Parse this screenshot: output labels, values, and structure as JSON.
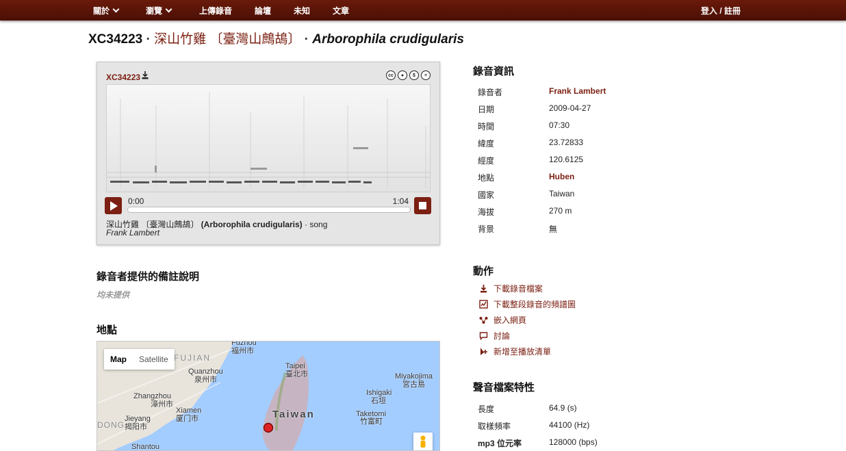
{
  "nav": {
    "about": "關於",
    "browse": "瀏覽",
    "upload": "上傳錄音",
    "forum": "論壇",
    "mystery": "未知",
    "articles": "文章",
    "login": "登入 / 註冊"
  },
  "title": {
    "id": "XC34223",
    "sep1": " · ",
    "common_name": "深山竹雞 〔臺灣山鷓鴣〕",
    "sep2": " · ",
    "scientific": "Arborophila crudigularis"
  },
  "player": {
    "id": "XC34223",
    "time_start": "0:00",
    "time_end": "1:04",
    "progress": 0,
    "caption_common": "深山竹雞 〔臺灣山鷓鴣〕 ",
    "caption_scientific": "(Arborophila crudigularis)",
    "caption_type": " · song",
    "recorder": "Frank Lambert",
    "license_icons": [
      "cc-icon",
      "by-icon",
      "nc-icon",
      "nd-icon"
    ]
  },
  "notes": {
    "heading": "錄音者提供的備註說明",
    "empty": "均未提供"
  },
  "location": {
    "heading": "地點",
    "map_button": "Map",
    "satellite_button": "Satellite",
    "labels": {
      "fuzhou": "Fuzhou",
      "fuzhou_cn": "福州市",
      "fujian": "FUJIAN",
      "quanzhou": "Quanzhou",
      "quanzhou_cn": "泉州市",
      "zhangzhou": "Zhangzhou",
      "zhangzhou_cn": "漳州市",
      "xiamen": "Xiamen",
      "xiamen_cn": "厦门市",
      "jieyang": "Jieyang",
      "jieyang_cn": "揭阳市",
      "dong": "DONG",
      "shantou": "Shantou",
      "taipei": "Taipei",
      "taipei_cn": "臺北市",
      "taiwan": "Taiwan",
      "ishigaki": "Ishigaki",
      "ishigaki_cn": "石垣",
      "taketomi": "Taketomi",
      "taketomi_cn": "竹富町",
      "miyakojima": "Miyakojima",
      "miyakojima_cn": "宮古島"
    }
  },
  "recording_info": {
    "heading": "錄音資訊",
    "rows": [
      {
        "k": "錄音者",
        "v": "Frank Lambert"
      },
      {
        "k": "日期",
        "v": "2009-04-27"
      },
      {
        "k": "時間",
        "v": "07:30"
      },
      {
        "k": "緯度",
        "v": "23.72833"
      },
      {
        "k": "經度",
        "v": "120.6125"
      },
      {
        "k": "地點",
        "v": "Huben"
      },
      {
        "k": "國家",
        "v": "Taiwan"
      },
      {
        "k": "海拔",
        "v": "270 m"
      },
      {
        "k": "背景",
        "v": "無"
      }
    ]
  },
  "actions": {
    "heading": "動作",
    "items": [
      {
        "label": "下載錄音檔案",
        "icon": "download-icon"
      },
      {
        "label": "下載整段錄音的頻譜圖",
        "icon": "sonogram-icon"
      },
      {
        "label": "嵌入網頁",
        "icon": "embed-icon"
      },
      {
        "label": "討論",
        "icon": "discuss-icon"
      },
      {
        "label": "新增至播放清單",
        "icon": "playlist-add-icon"
      }
    ]
  },
  "sound_properties": {
    "heading": "聲音檔案特性",
    "rows": [
      {
        "k": "長度",
        "v": "64.9 (s)"
      },
      {
        "k": "取樣頻率",
        "v": "44100 (Hz)"
      },
      {
        "k": "mp3 位元率",
        "v": "128000 (bps)"
      }
    ]
  },
  "colors": {
    "brand": "#7b2012",
    "nav_bg": "#5a1408"
  }
}
